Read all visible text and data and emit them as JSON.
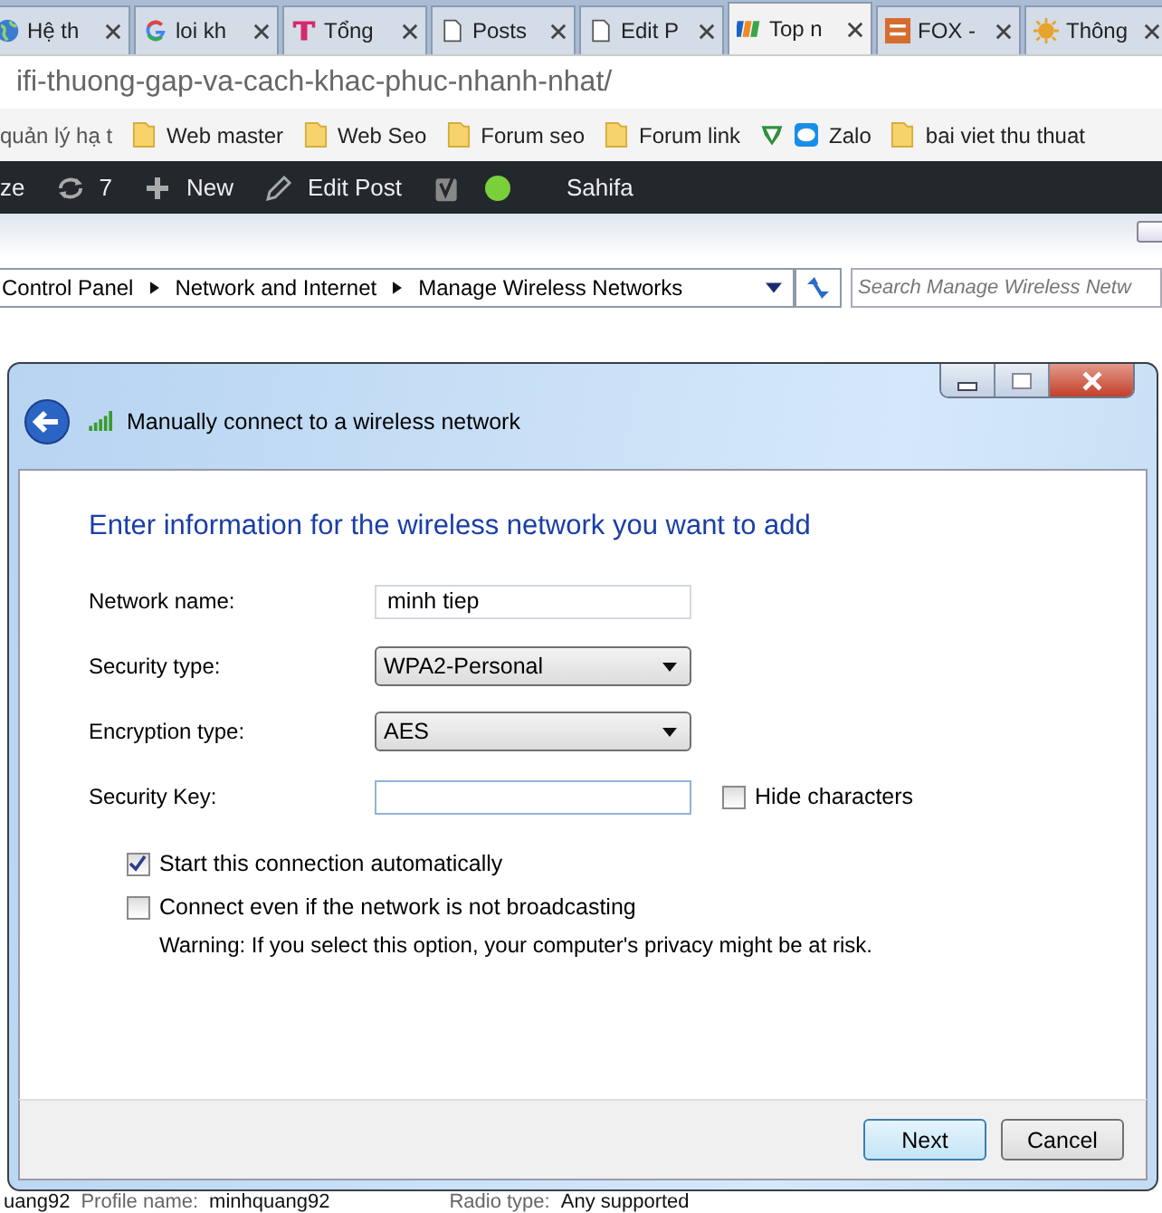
{
  "browser_tabs": [
    {
      "label": "Hệ th",
      "selected": false
    },
    {
      "label": "loi kh",
      "selected": false
    },
    {
      "label": "Tổng",
      "selected": false
    },
    {
      "label": "Posts",
      "selected": false
    },
    {
      "label": "Edit P",
      "selected": false
    },
    {
      "label": "Top n",
      "selected": true
    },
    {
      "label": "FOX -",
      "selected": false
    },
    {
      "label": "Thông",
      "selected": false
    }
  ],
  "address_bar": {
    "url": "ifi-thuong-gap-va-cach-khac-phuc-nhanh-nhat/"
  },
  "bookmarks": [
    {
      "label": "quản lý hạ t"
    },
    {
      "label": "Web master"
    },
    {
      "label": "Web Seo"
    },
    {
      "label": "Forum seo"
    },
    {
      "label": "Forum link"
    },
    {
      "label": "Zalo"
    },
    {
      "label": "bai viet thu thuat"
    }
  ],
  "admin_bar": [
    {
      "label": "ze"
    },
    {
      "label": "7"
    },
    {
      "label": "New"
    },
    {
      "label": "Edit Post"
    },
    {
      "label": "Sahifa"
    }
  ],
  "explorer": {
    "breadcrumb": [
      "Control Panel",
      "Network and Internet",
      "Manage Wireless Networks"
    ],
    "search": {
      "placeholder": "Search Manage Wireless Netw"
    }
  },
  "dialog": {
    "title": "Manually connect to a wireless network",
    "heading": "Enter information for the wireless network you want to add",
    "fields": [
      {
        "kind": "text",
        "label": "Network name:",
        "value": "minh tiep"
      },
      {
        "kind": "select",
        "label": "Security type:",
        "value": "WPA2-Personal"
      },
      {
        "kind": "select",
        "label": "Encryption type:",
        "value": "AES"
      },
      {
        "kind": "text",
        "label": "Security Key:",
        "option": {
          "label": "Hide characters",
          "checked": false
        }
      }
    ],
    "options": [
      {
        "label": "Start this connection automatically",
        "checked": true
      },
      {
        "label": "Connect even if the network is not broadcasting",
        "checked": false,
        "note": "Warning: If you select this option, your computer's privacy might be at risk."
      }
    ],
    "buttons": [
      {
        "label": "Next",
        "default": true
      },
      {
        "label": "Cancel",
        "default": false
      }
    ]
  },
  "background_row": [
    "uang92",
    "Profile name:",
    "minhquang92",
    "Radio type:",
    "Any supported"
  ]
}
